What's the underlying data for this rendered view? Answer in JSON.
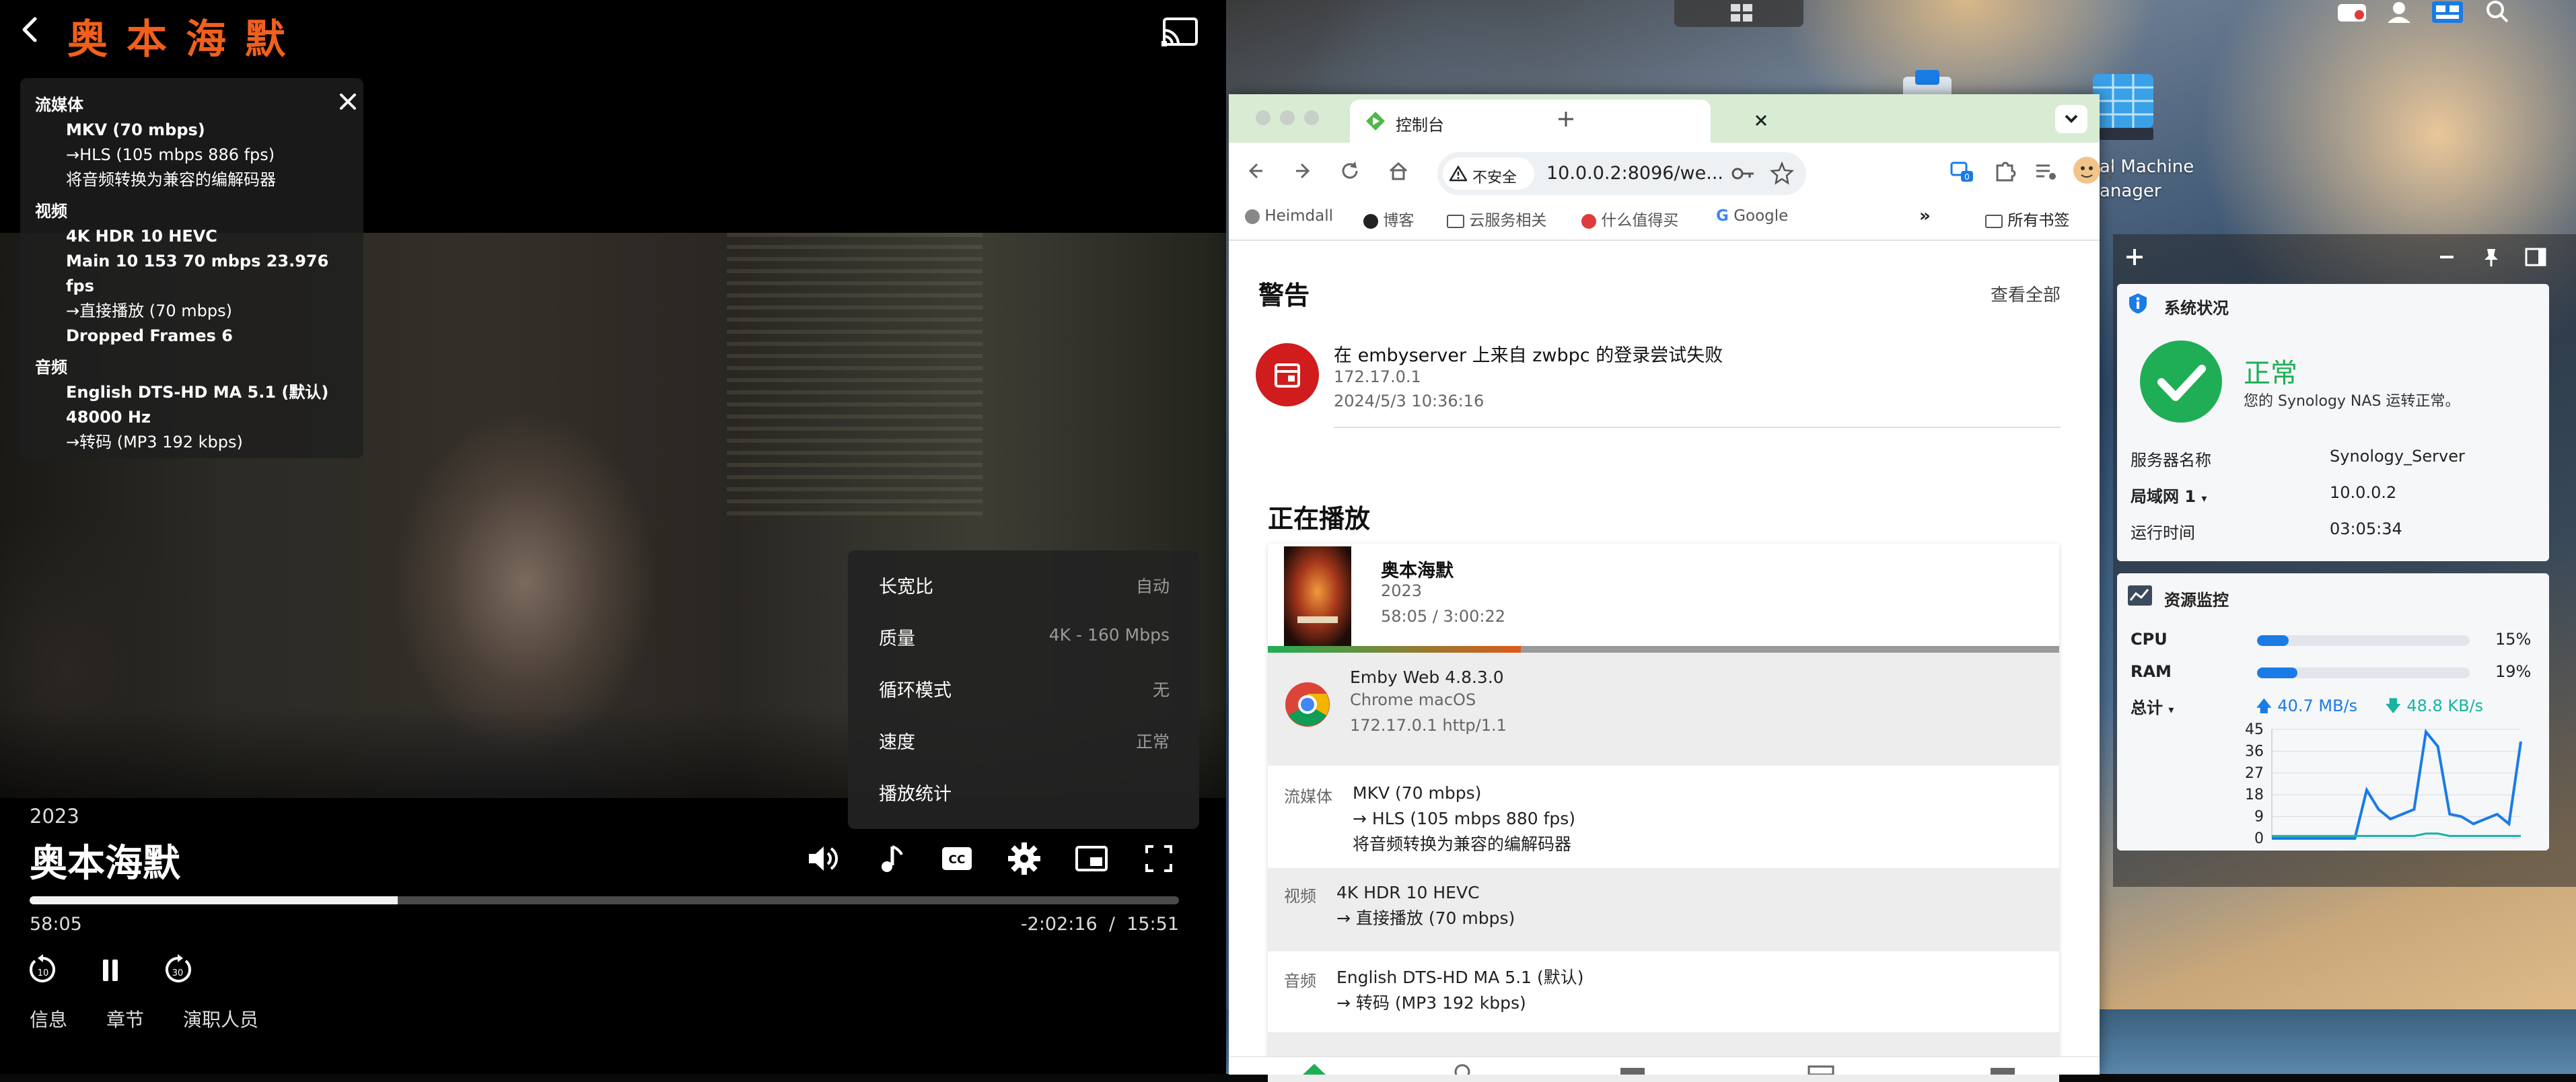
{
  "player": {
    "title": "奥本海默",
    "stats": {
      "stream_label": "流媒体",
      "stream_lines": [
        "MKV (70 mbps)",
        "→HLS (105 mbps 886 fps)",
        "将音频转换为兼容的编解码器"
      ],
      "video_label": "视频",
      "video_lines": [
        "4K HDR 10 HEVC",
        "Main 10 153 70 mbps 23.976 fps",
        "→直接播放 (70 mbps)",
        "Dropped Frames 6"
      ],
      "audio_label": "音频",
      "audio_lines": [
        "English DTS-HD MA 5.1 (默认)",
        "48000 Hz",
        "→转码 (MP3 192 kbps)"
      ]
    },
    "menu": [
      {
        "label": "长宽比",
        "value": "自动"
      },
      {
        "label": "质量",
        "value": "4K - 160 Mbps"
      },
      {
        "label": "循环模式",
        "value": "无"
      },
      {
        "label": "速度",
        "value": "正常"
      },
      {
        "label": "播放统计",
        "value": ""
      }
    ],
    "year": "2023",
    "movie_title": "奥本海默",
    "progress": 0.32,
    "elapsed": "58:05",
    "remaining": "-2:02:16",
    "time_sep": "/",
    "end_time": "15:51",
    "tabs": [
      "信息",
      "章节",
      "演职人员"
    ]
  },
  "browser": {
    "tab_title": "控制台",
    "insecure_label": "不安全",
    "url": "10.0.0.2:8096/we...",
    "ext_badge": "0",
    "bookmarks": [
      "Heimdall",
      "博客",
      "云服务相关",
      "什么值得买",
      "Google"
    ],
    "all_bookmarks": "所有书签",
    "alerts_title": "警告",
    "view_all": "查看全部",
    "alert": {
      "text": "在 embyserver 上来自 zwbpc 的登录尝试失败",
      "ip": "172.17.0.1",
      "time": "2024/5/3 10:36:16"
    },
    "now_playing_title": "正在播放",
    "np": {
      "title": "奥本海默",
      "year": "2023",
      "time": "58:05 / 3:00:22",
      "progress": 0.32,
      "client": "Emby Web 4.8.3.0",
      "device": "Chrome macOS",
      "addr": "172.17.0.1 http/1.1",
      "stream_label": "流媒体",
      "stream_lines": [
        "MKV (70 mbps)",
        "→  HLS (105 mbps 880 fps)",
        "将音频转换为兼容的编解码器"
      ],
      "video_label": "视频",
      "video_lines": [
        "4K HDR 10 HEVC",
        "→  直接播放 (70 mbps)"
      ],
      "audio_label": "音频",
      "audio_lines": [
        "English DTS-HD MA 5.1 (默认)",
        "→  转码 (MP3 192 kbps)"
      ]
    }
  },
  "desktop": {
    "vmm_label_1": "al Machine",
    "vmm_label_2": "anager",
    "system": {
      "title": "系统状况",
      "status": "正常",
      "status_desc": "您的 Synology NAS 运转正常。",
      "rows": [
        {
          "key": "服务器名称",
          "value": "Synology_Server"
        },
        {
          "key": "局域网 1",
          "value": "10.0.0.2"
        },
        {
          "key": "运行时间",
          "value": "03:05:34"
        }
      ]
    },
    "resource": {
      "title": "资源监控",
      "cpu_label": "CPU",
      "cpu": 15,
      "cpu_text": "15%",
      "ram_label": "RAM",
      "ram": 19,
      "ram_text": "19%",
      "total_label": "总计",
      "upload": "40.7 MB/s",
      "download": "48.8 KB/s",
      "chart_data": {
        "type": "line",
        "yticks": [
          45,
          36,
          27,
          18,
          9,
          0
        ],
        "ylim": [
          0,
          45
        ],
        "series": [
          {
            "values": [
              0,
              0,
              0,
              0,
              0,
              0,
              0,
              0,
              20,
              12,
              8,
              10,
              12,
              44,
              38,
              10,
              9,
              6,
              8,
              10,
              6,
              40
            ],
            "color": "#1a7be6"
          },
          {
            "values": [
              1,
              1,
              1,
              1,
              1,
              1,
              1,
              1,
              1,
              1,
              1,
              1,
              1,
              2,
              2,
              1,
              1,
              1,
              1,
              1,
              1,
              1
            ],
            "color": "#18b3a2"
          }
        ]
      }
    }
  }
}
